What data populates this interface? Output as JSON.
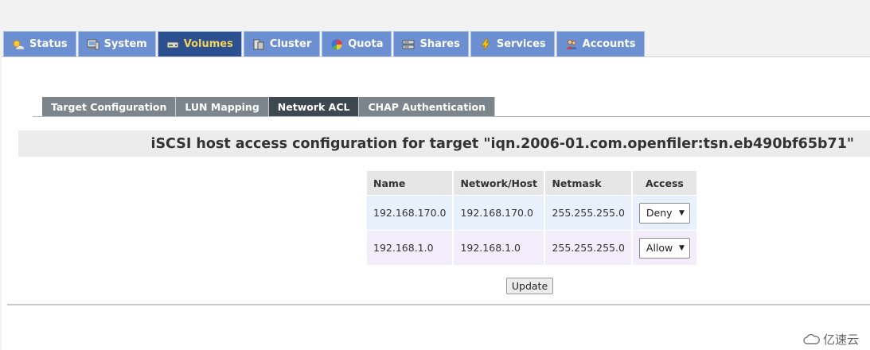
{
  "nav": {
    "tabs": [
      {
        "label": "Status",
        "icon": "sun-icon",
        "active": false
      },
      {
        "label": "System",
        "icon": "monitor-icon",
        "active": false
      },
      {
        "label": "Volumes",
        "icon": "drive-icon",
        "active": true
      },
      {
        "label": "Cluster",
        "icon": "cluster-icon",
        "active": false
      },
      {
        "label": "Quota",
        "icon": "pie-icon",
        "active": false
      },
      {
        "label": "Shares",
        "icon": "server-icon",
        "active": false
      },
      {
        "label": "Services",
        "icon": "bolt-icon",
        "active": false
      },
      {
        "label": "Accounts",
        "icon": "users-icon",
        "active": false
      }
    ]
  },
  "subtabs": [
    {
      "label": "Target Configuration",
      "active": false
    },
    {
      "label": "LUN Mapping",
      "active": false
    },
    {
      "label": "Network ACL",
      "active": true
    },
    {
      "label": "CHAP Authentication",
      "active": false
    }
  ],
  "title": "iSCSI host access configuration for target \"iqn.2006-01.com.openfiler:tsn.eb490bf65b71\"",
  "table": {
    "headers": [
      "Name",
      "Network/Host",
      "Netmask",
      "Access"
    ],
    "rows": [
      {
        "name": "192.168.170.0",
        "network": "192.168.170.0",
        "netmask": "255.255.255.0",
        "access": "Deny"
      },
      {
        "name": "192.168.1.0",
        "network": "192.168.1.0",
        "netmask": "255.255.255.0",
        "access": "Allow"
      }
    ]
  },
  "update_label": "Update",
  "watermark": "亿速云",
  "colors": {
    "tab_bg": "#6b8fd0",
    "tab_active_bg": "#2c4f90",
    "tab_active_text": "#f0d35c",
    "subtab_bg": "#7c858c",
    "subtab_active_bg": "#3e4850"
  }
}
